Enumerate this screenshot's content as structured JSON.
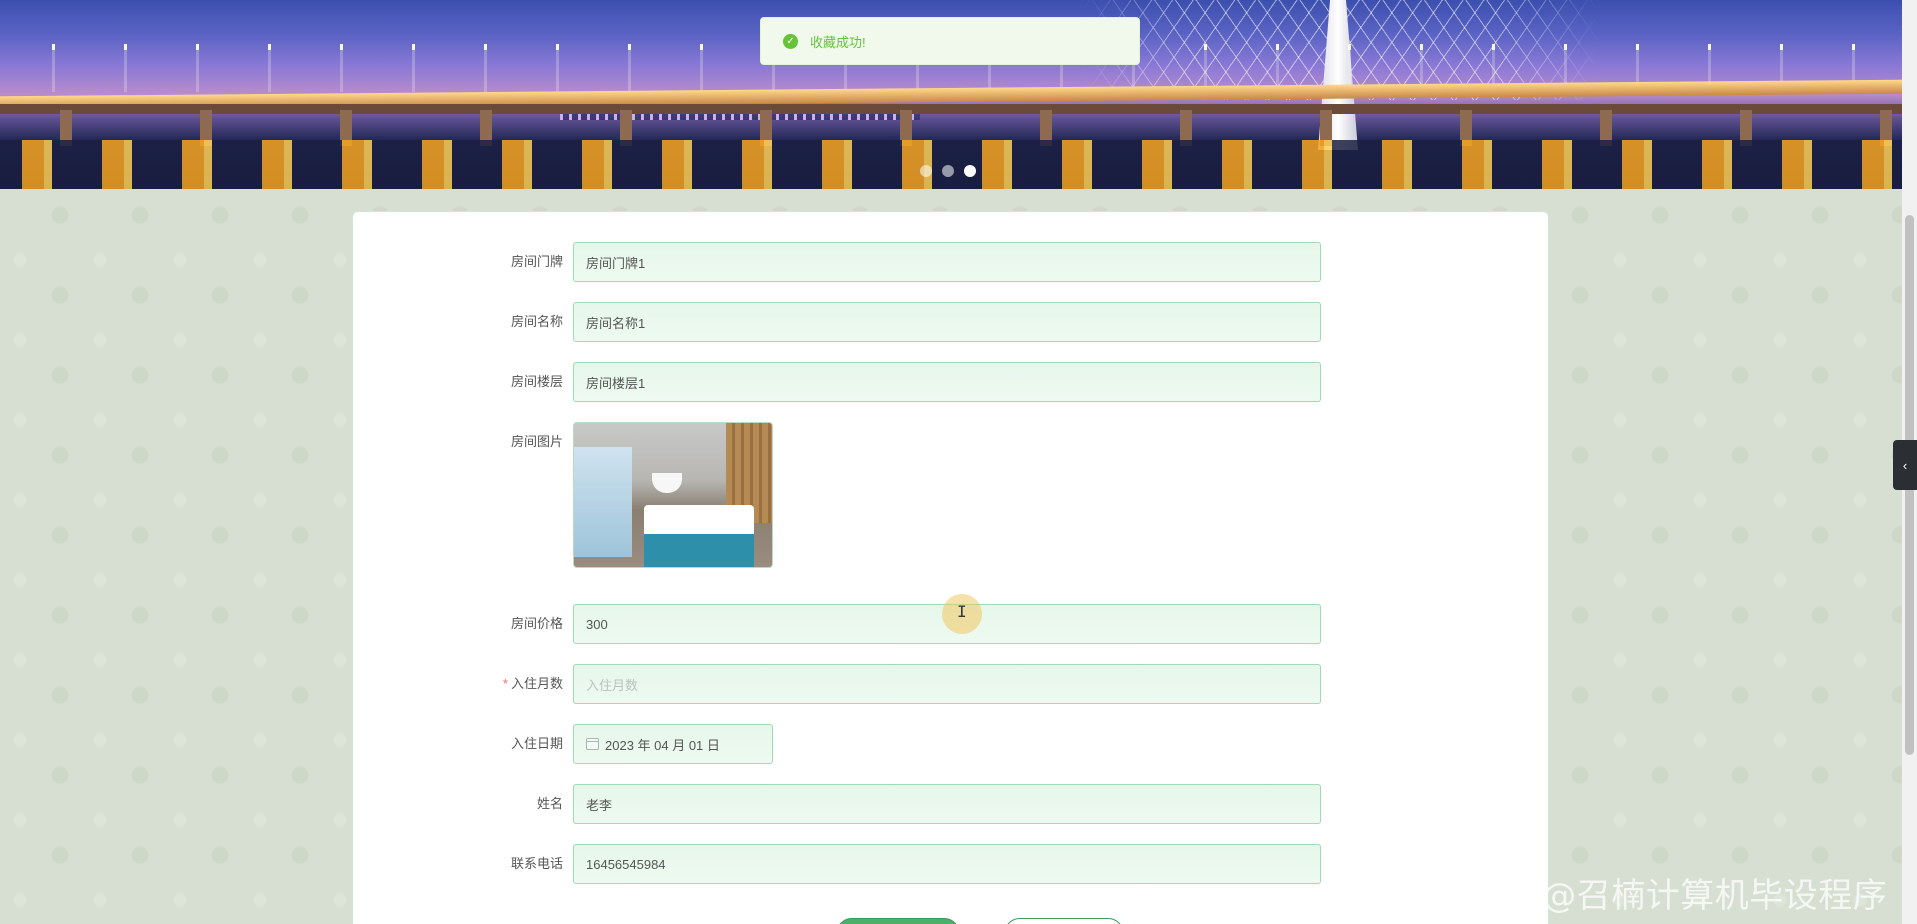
{
  "banner": {
    "slides": 3,
    "active_slide": 3
  },
  "toast": {
    "message": "收藏成功!",
    "type": "success",
    "color": "#67c23a"
  },
  "form": {
    "room_number": {
      "label": "房间门牌",
      "value": "房间门牌1"
    },
    "room_name": {
      "label": "房间名称",
      "value": "房间名称1"
    },
    "room_floor": {
      "label": "房间楼层",
      "value": "房间楼层1"
    },
    "room_image": {
      "label": "房间图片"
    },
    "room_price": {
      "label": "房间价格",
      "value": "300"
    },
    "months": {
      "label": "入住月数",
      "placeholder": "入住月数",
      "required_mark": "*"
    },
    "checkin_date": {
      "label": "入住日期",
      "value": "2023 年 04 月 01 日"
    },
    "name": {
      "label": "姓名",
      "value": "老李"
    },
    "phone": {
      "label": "联系电话",
      "value": "16456545984"
    }
  },
  "colors": {
    "accent": "#4caf6a",
    "input_bg": "#e6f7ea",
    "input_border": "#9fdbb4",
    "required": "#f56c6c"
  },
  "side_tab": {
    "icon": "chevron-left-icon",
    "glyph": "‹"
  },
  "watermark": "CSDN @召楠计算机毕设程序"
}
